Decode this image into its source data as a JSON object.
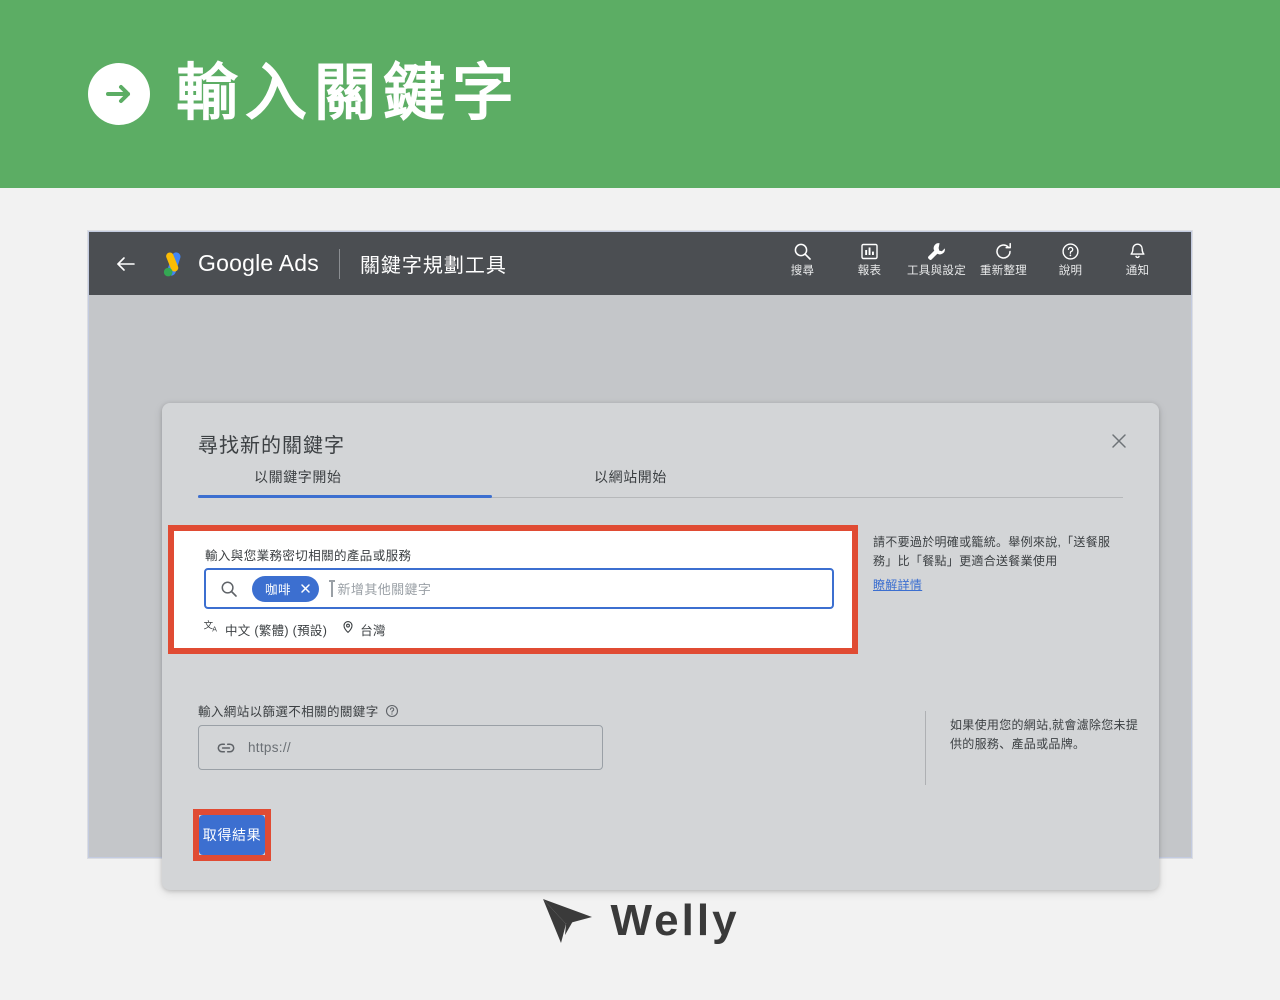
{
  "banner": {
    "arrow_icon": "arrow-right-circle-icon",
    "title": "輸入關鍵字",
    "bg_color": "#5cad64"
  },
  "browser": {
    "topbar": {
      "back_icon": "back-arrow-icon",
      "logo_icon": "google-ads-logo-icon",
      "brand_bold": "Google",
      "brand_light": " Ads",
      "tool_name": "關鍵字規劃工具",
      "actions": [
        {
          "icon": "search-icon",
          "label": "搜尋"
        },
        {
          "icon": "reports-bar-chart-icon",
          "label": "報表"
        },
        {
          "icon": "tools-wrench-icon",
          "label": "工具與設定"
        },
        {
          "icon": "refresh-icon",
          "label": "重新整理"
        },
        {
          "icon": "help-question-icon",
          "label": "說明"
        },
        {
          "icon": "bell-notification-icon",
          "label": "通知"
        }
      ]
    },
    "card": {
      "title": "尋找新的關鍵字",
      "close_icon": "close-x-icon",
      "tabs": [
        {
          "label": "以關鍵字開始",
          "active": true
        },
        {
          "label": "以網站開始",
          "active": false
        }
      ],
      "keyword_section": {
        "label": "輸入與您業務密切相關的產品或服務",
        "search_icon": "search-icon",
        "chips": [
          {
            "text": "咖啡",
            "remove_icon": "chip-close-x-icon"
          }
        ],
        "placeholder": "新增其他關鍵字",
        "meta": [
          {
            "icon": "language-translate-icon",
            "text": "中文 (繁體) (預設)"
          },
          {
            "icon": "location-pin-icon",
            "text": "台灣"
          }
        ],
        "hint": "請不要過於明確或籠統。舉例來說,「送餐服務」比「餐點」更適合送餐業使用",
        "hint_link": "瞭解詳情",
        "highlight_color": "#e04b33"
      },
      "website_section": {
        "label": "輸入網站以篩選不相關的關鍵字",
        "help_icon": "help-question-icon",
        "link_icon": "link-chain-icon",
        "placeholder": "https://",
        "hint": "如果使用您的網站,就會濾除您未提供的服務、產品或品牌。"
      },
      "submit": {
        "label": "取得結果",
        "color": "#3c6fd0",
        "highlight_color": "#e04b33"
      }
    }
  },
  "footer": {
    "logo_icon": "welly-paper-plane-icon",
    "brand": "Welly"
  }
}
